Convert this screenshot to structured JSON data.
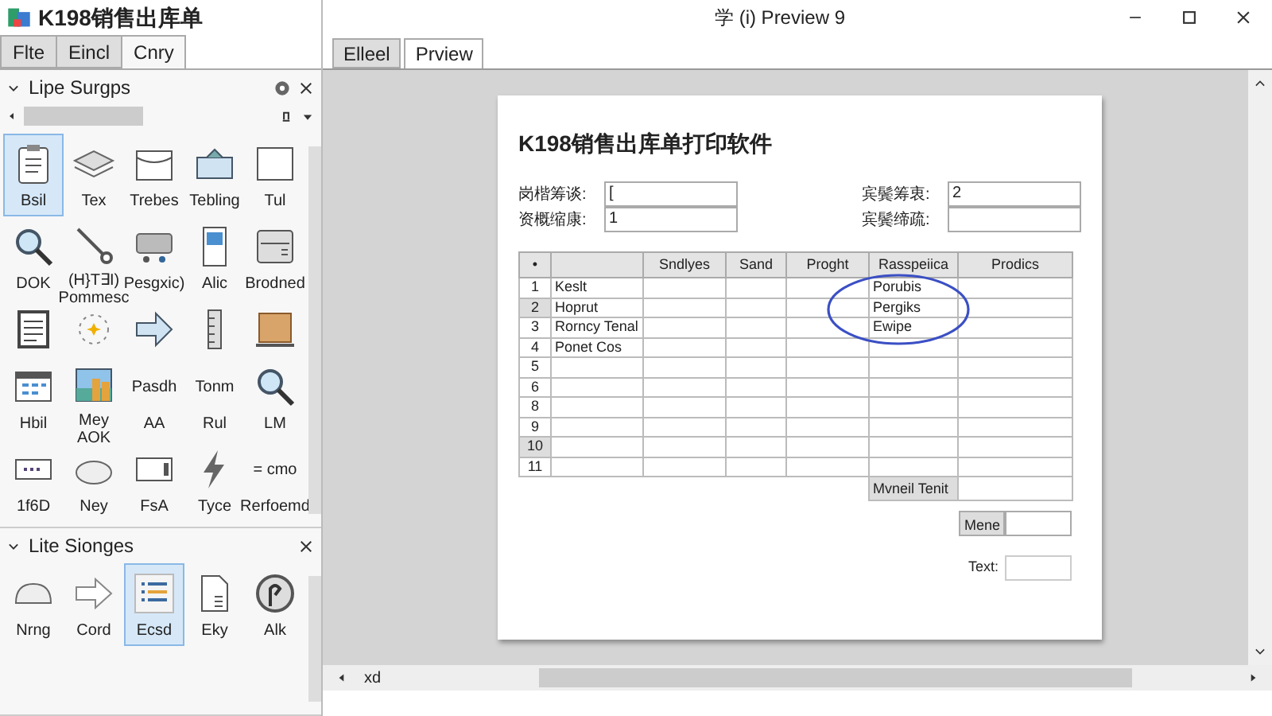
{
  "window": {
    "title": "K198销售出库单",
    "document_title": "学 (i) Preview 9"
  },
  "menu_tabs": [
    {
      "label": "Flte",
      "selected": false
    },
    {
      "label": "Eincl",
      "selected": false
    },
    {
      "label": "Cnry",
      "selected": true
    }
  ],
  "panels": [
    {
      "title": "Lipe Surgps",
      "expanded": true,
      "items": [
        {
          "label": "Bsil",
          "selected": true
        },
        {
          "label": "Tex",
          "selected": false
        },
        {
          "label": "Trebes",
          "selected": false
        },
        {
          "label": "Tebling",
          "selected": false
        },
        {
          "label": "Tul",
          "selected": false
        },
        {
          "label": "DOK",
          "selected": false
        },
        {
          "label": "(H}T∃I) Pommesc",
          "selected": false
        },
        {
          "label": "Pesgxic)",
          "selected": false
        },
        {
          "label": "Alic",
          "selected": false
        },
        {
          "label": "Brodned",
          "selected": false
        },
        {
          "selected": false
        },
        {
          "selected": false
        },
        {
          "selected": false
        },
        {
          "selected": false
        },
        {
          "selected": false
        },
        {
          "label": "Hbil",
          "selected": false
        },
        {
          "label": "Mey AOK",
          "selected": false
        },
        {
          "glyph_text": "Pasdh",
          "label": "AA",
          "selected": false
        },
        {
          "glyph_text": "Tonm",
          "label": "Rul",
          "selected": false
        },
        {
          "label": "LM",
          "selected": false
        },
        {
          "label": "1f6D",
          "selected": false
        },
        {
          "label": "Ney",
          "selected": false
        },
        {
          "label": "FsA",
          "selected": false
        },
        {
          "label": "Tyce",
          "selected": false
        },
        {
          "glyph_text": "= cmo",
          "label": "Rerfoemd",
          "selected": false
        }
      ]
    },
    {
      "title": "Lite Sionges",
      "expanded": true,
      "items": [
        {
          "label": "Nrng",
          "selected": false
        },
        {
          "label": "Cord",
          "selected": false
        },
        {
          "label": "Ecsd",
          "selected": true
        },
        {
          "label": "Eky",
          "selected": false
        },
        {
          "label": "Alk",
          "selected": false
        }
      ]
    }
  ],
  "doc_tabs": [
    {
      "label": "Elleel",
      "selected": false
    },
    {
      "label": "Prview",
      "selected": true
    }
  ],
  "page": {
    "title": "K198销售出库单打印软件",
    "fields_left": [
      {
        "label": "岗楷筹谈:",
        "value": "["
      },
      {
        "label": "资概缩康:",
        "value": "1"
      }
    ],
    "fields_right": [
      {
        "label": "宾鬓筹衷:",
        "value": "2"
      },
      {
        "label": "宾鬓缔疏:"
      }
    ],
    "table": {
      "columns": [
        "•",
        "",
        "Sndlyes",
        "Sand",
        "Proght",
        "Rasspeiica",
        "Prodics"
      ],
      "rows": [
        {
          "number": "1",
          "name": "Keslt",
          "column_6": "Porubis",
          "selected": false
        },
        {
          "number": "2",
          "name": "Hoprut",
          "column_6": "Pergiks",
          "selected": true
        },
        {
          "number": "3",
          "name": "Rorncy Tenal",
          "column_6": "Ewipe",
          "selected": false
        },
        {
          "number": "4",
          "name": "Ponet Cos",
          "selected": false
        },
        {
          "number": "5",
          "selected": false
        },
        {
          "number": "6",
          "selected": false
        },
        {
          "number": "8",
          "selected": false
        },
        {
          "number": "9",
          "selected": false
        },
        {
          "number": "10",
          "selected": true
        },
        {
          "number": "11",
          "selected": false
        }
      ],
      "footer": "Mvneil Tenit"
    },
    "mene_label": "Mene",
    "text_label": "Text:"
  },
  "status": "xd"
}
